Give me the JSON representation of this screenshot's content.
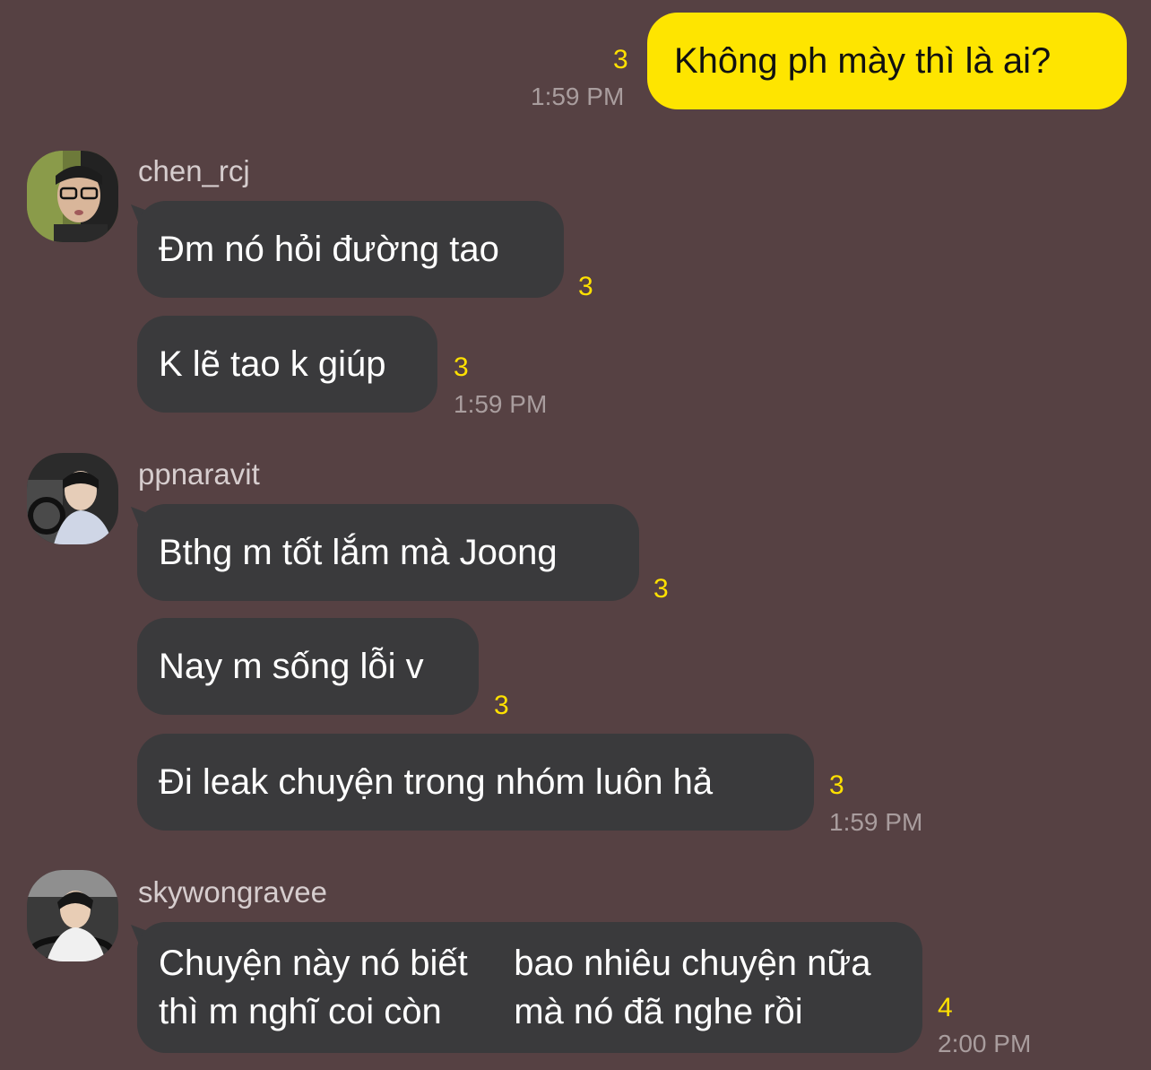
{
  "messages": {
    "m1": {
      "text": "Không ph mày thì là ai?",
      "unread": "3",
      "time": "1:59 PM"
    },
    "g1": {
      "sender": "chen_rcj",
      "m2": {
        "text": "Đm nó hỏi đường tao",
        "unread": "3"
      },
      "m3": {
        "text": "K lẽ tao k giúp",
        "unread": "3",
        "time": "1:59 PM"
      }
    },
    "g2": {
      "sender": "ppnaravit",
      "m4": {
        "text": "Bthg m tốt lắm mà Joong",
        "unread": "3"
      },
      "m5": {
        "text": "Nay m sống lỗi v",
        "unread": "3"
      },
      "m6": {
        "text": "Đi leak chuyện trong nhóm luôn hả",
        "unread": "3",
        "time": "1:59 PM"
      }
    },
    "g3": {
      "sender": "skywongravee",
      "m7": {
        "line1": "Chuyện này nó biết thì m nghĩ coi còn",
        "line2": "bao nhiêu chuyện nữa mà nó đã nghe rồi",
        "unread": "4",
        "time": "2:00 PM"
      }
    }
  },
  "colors": {
    "background": "#564143",
    "incoming_bubble": "#3a3a3c",
    "outgoing_bubble": "#fee500",
    "unread_count": "#ffe100",
    "timestamp": "#a99d9e"
  }
}
